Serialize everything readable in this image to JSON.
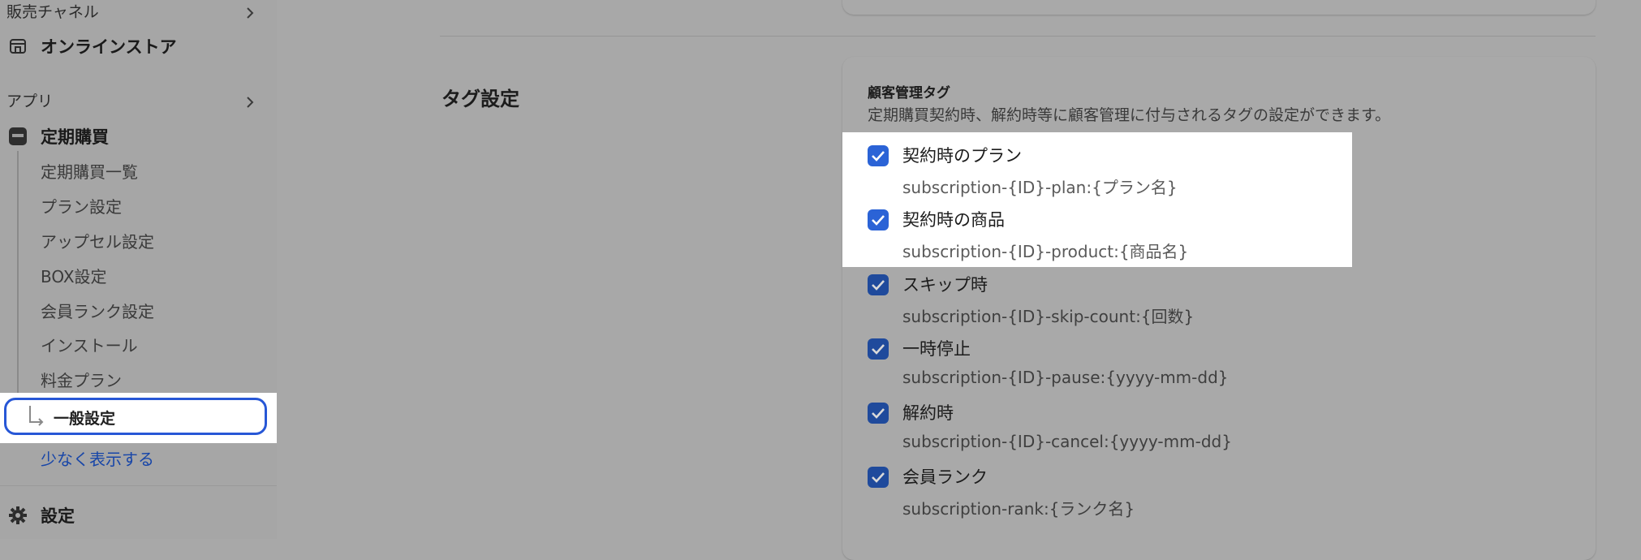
{
  "sidebar": {
    "sales_channels_label": "販売チャネル",
    "online_store_label": "オンラインストア",
    "apps_label": "アプリ",
    "app_name": "定期購買",
    "sub_items": [
      "定期購買一覧",
      "プラン設定",
      "アップセル設定",
      "BOX設定",
      "会員ランク設定",
      "インストール",
      "料金プラン"
    ],
    "selected_item": "一般設定",
    "show_less": "少なく表示する",
    "settings_label": "設定"
  },
  "main": {
    "section_title": "タグ設定",
    "card_heading": "顧客管理タグ",
    "card_description": "定期購買契約時、解約時等に顧客管理に付与されるタグの設定ができます。",
    "options": [
      {
        "label": "契約時のプラン",
        "tag": "subscription-{ID}-plan:{プラン名}",
        "checked": true
      },
      {
        "label": "契約時の商品",
        "tag": "subscription-{ID}-product:{商品名}",
        "checked": true
      },
      {
        "label": "スキップ時",
        "tag": "subscription-{ID}-skip-count:{回数}",
        "checked": true
      },
      {
        "label": "一時停止",
        "tag": "subscription-{ID}-pause:{yyyy-mm-dd}",
        "checked": true
      },
      {
        "label": "解約時",
        "tag": "subscription-{ID}-cancel:{yyyy-mm-dd}",
        "checked": true
      },
      {
        "label": "会員ランク",
        "tag": "subscription-rank:{ランク名}",
        "checked": true
      }
    ]
  },
  "colors": {
    "overlay_gray": "#a8a8a8",
    "checkbox_dim": "#1f4a9c",
    "checkbox_bright": "#2b63d6",
    "link_blue": "#1846a8",
    "selected_border": "#2757d6"
  }
}
